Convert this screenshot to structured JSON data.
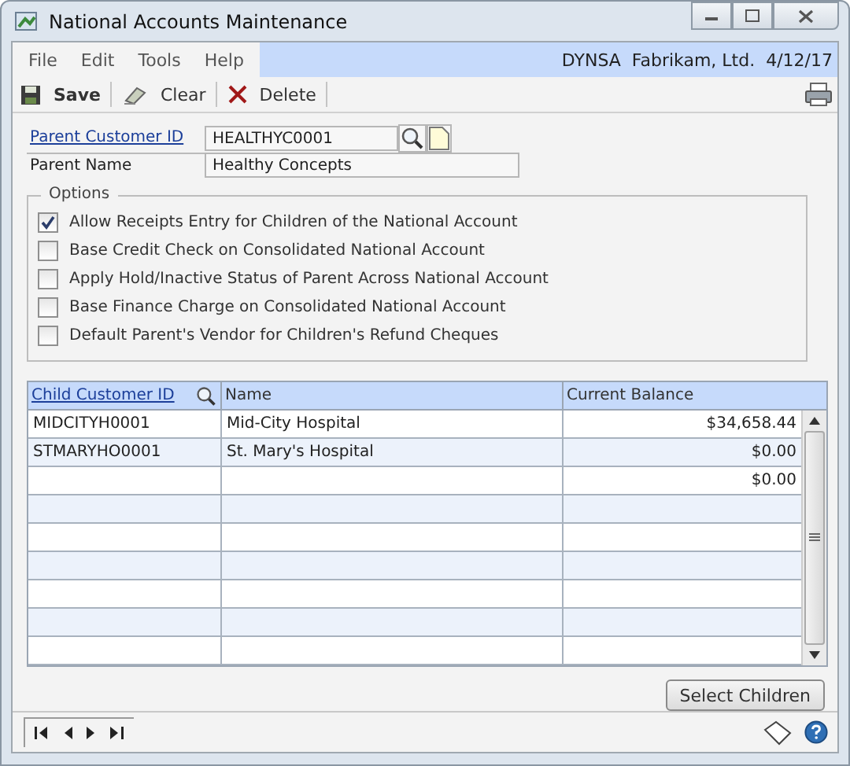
{
  "window": {
    "title": "National Accounts Maintenance"
  },
  "menu": [
    "File",
    "Edit",
    "Tools",
    "Help"
  ],
  "company_info": "DYNSA  Fabrikam, Ltd.  4/12/17",
  "toolbar": [
    {
      "kind": "save",
      "label": "Save"
    },
    {
      "kind": "clear",
      "label": "Clear"
    },
    {
      "kind": "delete",
      "label": "Delete"
    }
  ],
  "parent_customer_id": {
    "label": "Parent Customer ID",
    "value": "HEALTHYC0001"
  },
  "parent_name": {
    "label": "Parent Name",
    "value": "Healthy Concepts"
  },
  "options": {
    "title": "Options",
    "items": [
      {
        "label": "Allow Receipts Entry for Children of the National Account",
        "checked": true
      },
      {
        "label": "Base Credit Check on Consolidated National Account",
        "checked": false
      },
      {
        "label": "Apply Hold/Inactive Status of Parent Across National Account",
        "checked": false
      },
      {
        "label": "Base Finance Charge on Consolidated National Account",
        "checked": false
      },
      {
        "label": "Default Parent's Vendor for Children's Refund Cheques",
        "checked": false
      }
    ]
  },
  "table": {
    "columns": [
      "Child Customer ID",
      "Name",
      "Current Balance"
    ],
    "rows": [
      {
        "id": "MIDCITYH0001",
        "name": "Mid-City Hospital",
        "balance": "$34,658.44"
      },
      {
        "id": "STMARYHO0001",
        "name": "St. Mary's Hospital",
        "balance": "$0.00"
      },
      {
        "balance": "$0.00"
      },
      {},
      {},
      {},
      {},
      {},
      {}
    ]
  },
  "select_children_button": "Select Children"
}
